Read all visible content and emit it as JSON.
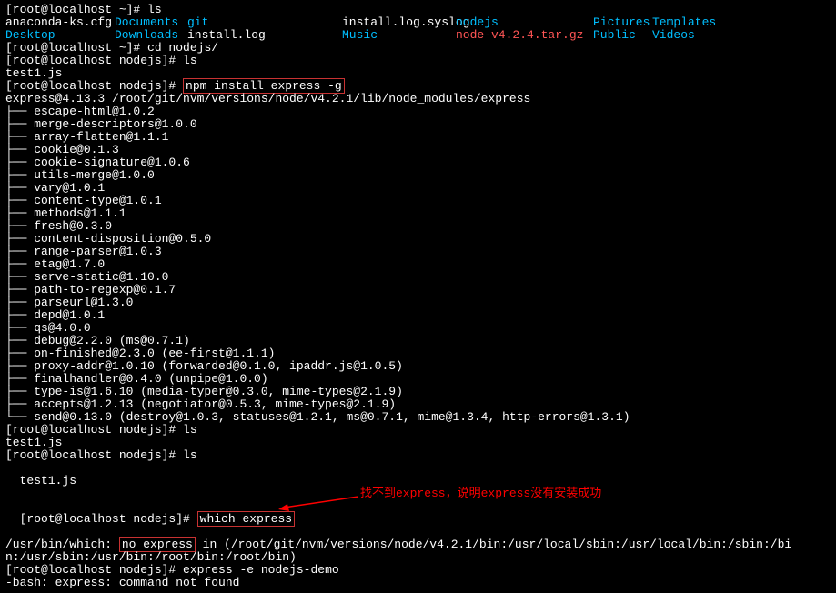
{
  "prompts": {
    "home": "[root@localhost ~]# ",
    "nodejs": "[root@localhost nodejs]# "
  },
  "cmds": {
    "ls": "ls",
    "cd": "cd nodejs/",
    "npm_install": "npm install express -g",
    "which": "which express",
    "express_demo": "express -e nodejs-demo"
  },
  "ls1": {
    "r1": [
      "anaconda-ks.cfg",
      "Documents",
      "git",
      "install.log.syslog",
      "nodejs",
      "Pictures",
      "Templates"
    ],
    "r2": [
      "Desktop",
      "Downloads",
      "install.log",
      "Music",
      "node-v4.2.4.tar.gz",
      "Public",
      "Videos"
    ]
  },
  "test1": "test1.js",
  "express_line": "express@4.13.3 /root/git/nvm/versions/node/v4.2.1/lib/node_modules/express",
  "deps": [
    "escape-html@1.0.2",
    "merge-descriptors@1.0.0",
    "array-flatten@1.1.1",
    "cookie@0.1.3",
    "cookie-signature@1.0.6",
    "utils-merge@1.0.0",
    "vary@1.0.1",
    "content-type@1.0.1",
    "methods@1.1.1",
    "fresh@0.3.0",
    "content-disposition@0.5.0",
    "range-parser@1.0.3",
    "etag@1.7.0",
    "serve-static@1.10.0",
    "path-to-regexp@0.1.7",
    "parseurl@1.3.0",
    "depd@1.0.1",
    "qs@4.0.0",
    "debug@2.2.0 (ms@0.7.1)",
    "on-finished@2.3.0 (ee-first@1.1.1)",
    "proxy-addr@1.0.10 (forwarded@0.1.0, ipaddr.js@1.0.5)",
    "finalhandler@0.4.0 (unpipe@1.0.0)",
    "type-is@1.6.10 (media-typer@0.3.0, mime-types@2.1.9)",
    "accepts@1.2.13 (negotiator@0.5.3, mime-types@2.1.9)",
    "send@0.13.0 (destroy@1.0.3, statuses@1.2.1, ms@0.7.1, mime@1.3.4, http-errors@1.3.1)"
  ],
  "which_out": {
    "prefix": "/usr/bin/which:",
    "no_express": "no express",
    "in": " in (/root/git/nvm/versions/node/v4.2.1/bin:/usr/local/sbin:/usr/local/bin:/sbin:/bi",
    "line2": "n:/usr/sbin:/usr/bin:/root/bin:/root/bin)"
  },
  "annotation": "找不到express，说明express没有安装成功",
  "bash_err": "-bash: express: command not found",
  "tree_mid": "├── ",
  "tree_end": "└── "
}
